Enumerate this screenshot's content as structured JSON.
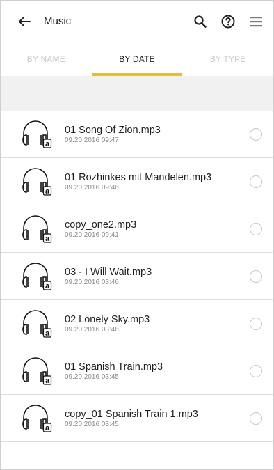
{
  "header": {
    "title": "Music"
  },
  "tabs": [
    {
      "label": "BY NAME",
      "active": false
    },
    {
      "label": "BY DATE",
      "active": true
    },
    {
      "label": "BY TYPE",
      "active": false
    }
  ],
  "colors": {
    "accent": "#f2c200",
    "inactive_tab": "#c8c8c8",
    "divider": "#dedede"
  },
  "files": [
    {
      "name": "01 Song Of Zion.mp3",
      "date": "09.20.2016 09:47"
    },
    {
      "name": "01 Rozhinkes mit Mandelen.mp3",
      "date": "09.20.2016 09:46"
    },
    {
      "name": "copy_one2.mp3",
      "date": "09.20.2016 09:41"
    },
    {
      "name": "03 - I Will Wait.mp3",
      "date": "09.20.2016 03:46"
    },
    {
      "name": "02 Lonely Sky.mp3",
      "date": "09.20.2016 03:46"
    },
    {
      "name": "01 Spanish Train.mp3",
      "date": "09.20.2016 03:45"
    },
    {
      "name": "copy_01 Spanish Train 1.mp3",
      "date": "09.20.2016 03:45"
    }
  ]
}
